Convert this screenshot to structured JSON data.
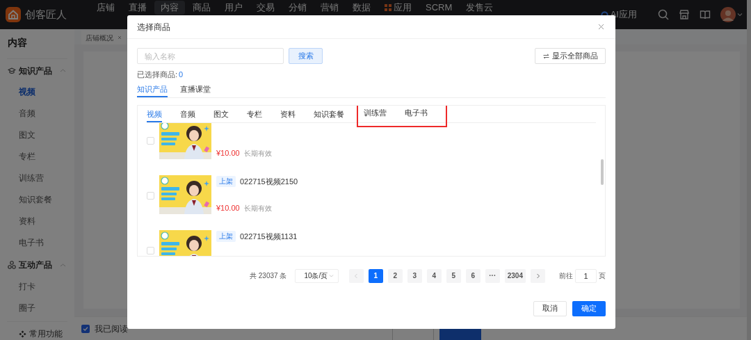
{
  "top_nav": {
    "logo_text": "创客匠人",
    "items": [
      {
        "label": "店铺",
        "selected": false,
        "kind": "text"
      },
      {
        "label": "直播",
        "selected": false,
        "kind": "text"
      },
      {
        "label": "内容",
        "selected": true,
        "kind": "text"
      },
      {
        "label": "商品",
        "selected": false,
        "kind": "text"
      },
      {
        "label": "用户",
        "selected": false,
        "kind": "text"
      },
      {
        "label": "交易",
        "selected": false,
        "kind": "text"
      },
      {
        "label": "分销",
        "selected": false,
        "kind": "text"
      },
      {
        "label": "营销",
        "selected": false,
        "kind": "text"
      },
      {
        "label": "数据",
        "selected": false,
        "kind": "text"
      },
      {
        "label": "应用",
        "selected": false,
        "kind": "grid"
      },
      {
        "label": "SCRM",
        "selected": false,
        "kind": "text"
      },
      {
        "label": "发售云",
        "selected": false,
        "kind": "text"
      }
    ],
    "ai_label": "AI应用"
  },
  "sidebar": {
    "title": "内容",
    "groups": [
      {
        "label": "知识产品",
        "kind": "course",
        "expanded": true,
        "children": [
          {
            "label": "视频",
            "selected": true
          },
          {
            "label": "音频",
            "selected": false
          },
          {
            "label": "图文",
            "selected": false
          },
          {
            "label": "专栏",
            "selected": false
          },
          {
            "label": "训练营",
            "selected": false
          },
          {
            "label": "知识套餐",
            "selected": false
          },
          {
            "label": "资料",
            "selected": false
          },
          {
            "label": "电子书",
            "selected": false
          }
        ]
      },
      {
        "label": "互动产品",
        "kind": "interact",
        "expanded": true,
        "children": [
          {
            "label": "打卡",
            "selected": false
          },
          {
            "label": "圈子",
            "selected": false
          }
        ]
      }
    ],
    "footer": "常用功能"
  },
  "page_tabs": [
    {
      "label": "店铺概况"
    }
  ],
  "agreement": {
    "checked": true,
    "text": "我已阅读"
  },
  "dialog": {
    "title": "选择商品",
    "search": {
      "placeholder": "输入名称",
      "button": "搜索"
    },
    "show_all_button": "显示全部商品",
    "selected_count": {
      "label": "已选择商品:",
      "value": "0"
    },
    "category_tabs": [
      {
        "label": "知识产品",
        "selected": true
      },
      {
        "label": "直播课堂",
        "selected": false
      }
    ],
    "type_tabs": [
      {
        "label": "视频",
        "selected": true,
        "highlighted": false
      },
      {
        "label": "音频",
        "selected": false,
        "highlighted": false
      },
      {
        "label": "图文",
        "selected": false,
        "highlighted": false
      },
      {
        "label": "专栏",
        "selected": false,
        "highlighted": false
      },
      {
        "label": "资料",
        "selected": false,
        "highlighted": false
      },
      {
        "label": "知识套餐",
        "selected": false,
        "highlighted": false
      },
      {
        "label": "训练营",
        "selected": false,
        "highlighted": true
      },
      {
        "label": "电子书",
        "selected": false,
        "highlighted": true
      }
    ],
    "products": [
      {
        "checked": false,
        "price": "¥10.00",
        "validity": "长期有效"
      },
      {
        "checked": false,
        "tag": "上架",
        "name": "022715视频2150",
        "price": "¥10.00",
        "validity": "长期有效"
      },
      {
        "checked": false,
        "tag": "上架",
        "name": "022715视频1131"
      }
    ],
    "pagination": {
      "total": "共 23037 条",
      "page_size": "10条/页",
      "pages": [
        {
          "label": "1",
          "selected": true
        },
        {
          "label": "2",
          "selected": false
        },
        {
          "label": "3",
          "selected": false
        },
        {
          "label": "4",
          "selected": false
        },
        {
          "label": "5",
          "selected": false
        },
        {
          "label": "6",
          "selected": false
        },
        {
          "label": "···",
          "selected": false
        },
        {
          "label": "2304",
          "selected": false
        }
      ],
      "goto_label": "前往",
      "goto_value": "1",
      "page_unit": "页"
    },
    "buttons": {
      "cancel": "取消",
      "confirm": "确定"
    }
  }
}
